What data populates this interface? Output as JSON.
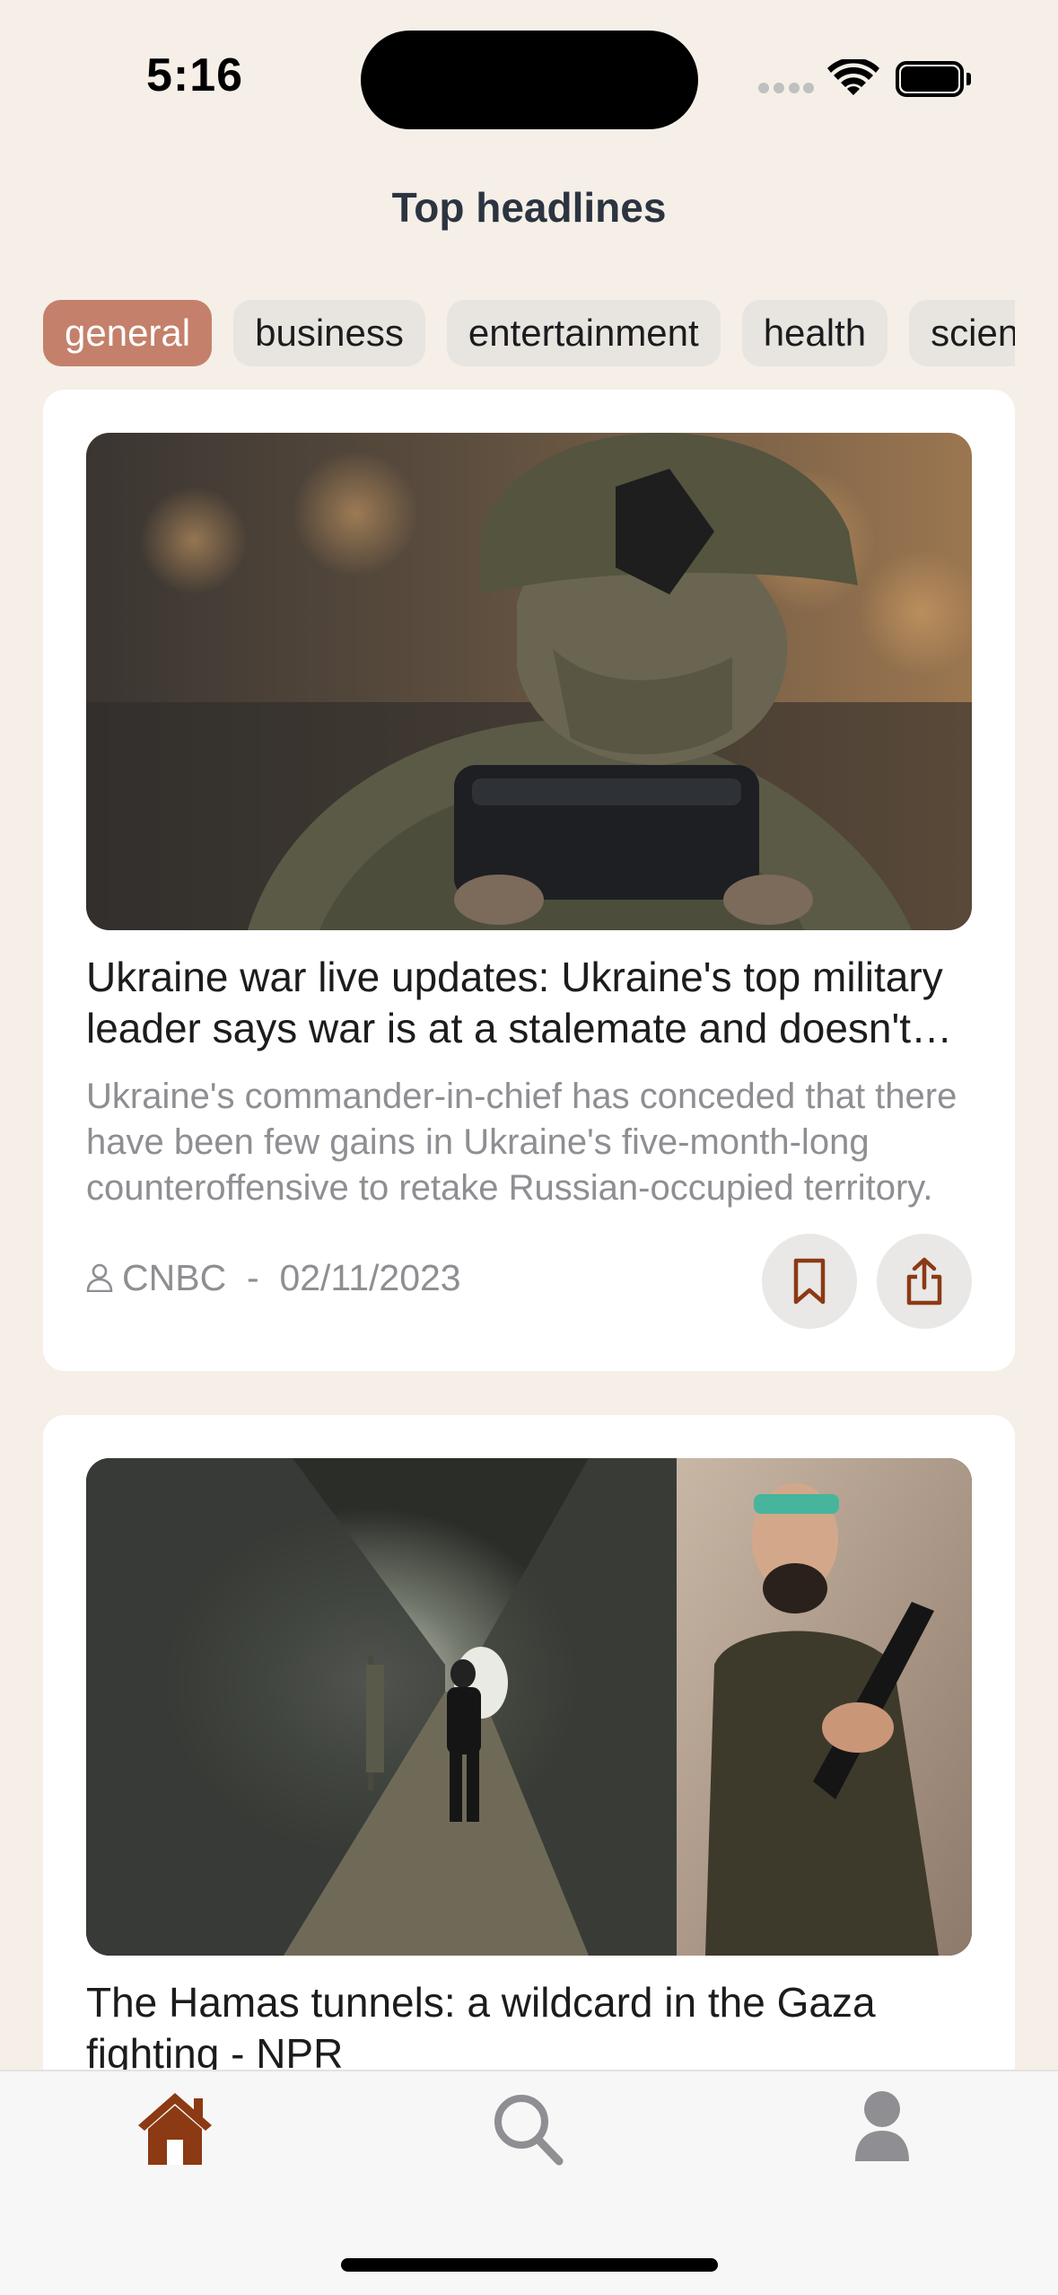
{
  "status_bar": {
    "time": "5:16"
  },
  "page_title": "Top headlines",
  "categories": [
    {
      "label": "general",
      "active": true
    },
    {
      "label": "business",
      "active": false
    },
    {
      "label": "entertainment",
      "active": false
    },
    {
      "label": "health",
      "active": false
    },
    {
      "label": "science",
      "active": false
    }
  ],
  "articles": [
    {
      "image": "soldier-holding-device-photo",
      "title": "Ukraine war live updates: Ukraine's top military leader says war is at a stalemate and doesn't expect a breakthrough soon",
      "description": "Ukraine's commander-in-chief has conceded that there have been few gains in Ukraine's five-month-long counteroffensive to retake Russian-occupied territory.",
      "source": "CNBC",
      "separator": "-",
      "date": "02/11/2023"
    },
    {
      "image": "tunnel-with-poster-photo",
      "title": "The Hamas tunnels: a wildcard in the Gaza fighting - NPR",
      "description": "",
      "source": "",
      "separator": "",
      "date": ""
    }
  ],
  "tab_bar": {
    "items": [
      {
        "icon": "home-icon",
        "active": true
      },
      {
        "icon": "search-icon",
        "active": false
      },
      {
        "icon": "profile-icon",
        "active": false
      }
    ]
  },
  "colors": {
    "background": "#f5efe8",
    "accent": "#c4806a",
    "active_tab_icon": "#8b3a14",
    "inactive_tab_icon": "#8e8e93",
    "card": "#ffffff",
    "secondary_text": "#8e8e93"
  }
}
